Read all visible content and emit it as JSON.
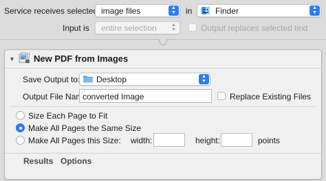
{
  "header": {
    "service_label": "Service receives selected",
    "input_type": "image files",
    "in_label": "in",
    "app": "Finder",
    "input_is_label": "Input is",
    "input_is_value": "entire selection",
    "replace_label": "Output replaces selected text"
  },
  "action": {
    "title": "New PDF from Images",
    "save_output_label": "Save Output to:",
    "save_location": "Desktop",
    "output_file_label": "Output File Name",
    "output_file_value": "converted Image",
    "replace_existing_label": "Replace Existing Files",
    "options": [
      {
        "label": "Size Each Page to Fit",
        "selected": false
      },
      {
        "label": "Make All Pages the Same Size",
        "selected": true
      },
      {
        "label": "Make All Pages this Size:",
        "selected": false
      }
    ],
    "width_label": "width:",
    "height_label": "height:",
    "points_label": "points",
    "tabs": [
      "Results",
      "Options"
    ]
  },
  "colors": {
    "accent": "#2d7df6",
    "background": "#dcdcdc",
    "panel": "#f0f0f0"
  }
}
